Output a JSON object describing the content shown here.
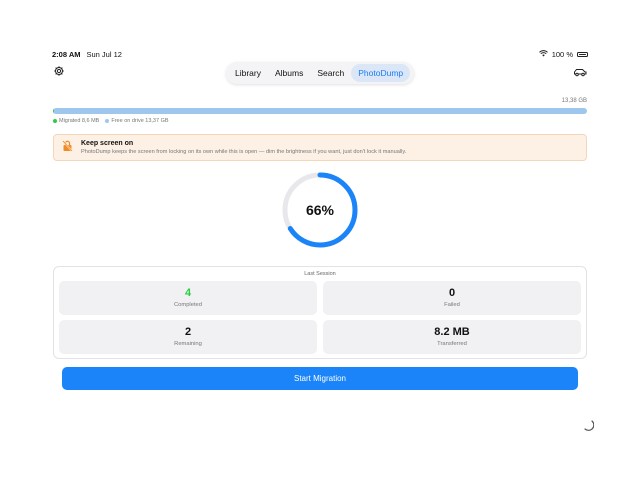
{
  "status_bar": {
    "time": "2:08 AM",
    "date": "Sun Jul 12",
    "battery_text": "100 %"
  },
  "toolbar": {
    "settings_icon": "gear-icon",
    "car_icon": "car-icon"
  },
  "tabs": [
    {
      "label": "Library",
      "active": false
    },
    {
      "label": "Albums",
      "active": false
    },
    {
      "label": "Search",
      "active": false
    },
    {
      "label": "PhotoDump",
      "active": true
    }
  ],
  "storage": {
    "total_label": "13,38 GB",
    "migrated_label": "Migrated 8,6 MB",
    "free_label": "Free on drive 13,37 GB",
    "migrated_fraction": 0.0006,
    "colors": {
      "migrated": "#2ecc40",
      "free": "#9fc7ee"
    }
  },
  "notice": {
    "icon": "no-lock-icon",
    "title": "Keep screen on",
    "body": "PhotoDump keeps the screen from locking on its own while this is open — dim the brightness if you want, just don't lock it manually."
  },
  "progress": {
    "label": "66%",
    "fraction": 0.66,
    "color": "#1a84f8",
    "track_color": "#e8e8ec"
  },
  "session": {
    "title": "Last Session",
    "stats": [
      {
        "value": "4",
        "label": "Completed",
        "color": "#2ecc40"
      },
      {
        "value": "0",
        "label": "Failed",
        "color": "#111111"
      },
      {
        "value": "2",
        "label": "Remaining",
        "color": "#111111"
      },
      {
        "value": "8.2 MB",
        "label": "Transferred",
        "color": "#111111"
      }
    ]
  },
  "start_button": {
    "label": "Start Migration",
    "color": "#1a84f8"
  }
}
